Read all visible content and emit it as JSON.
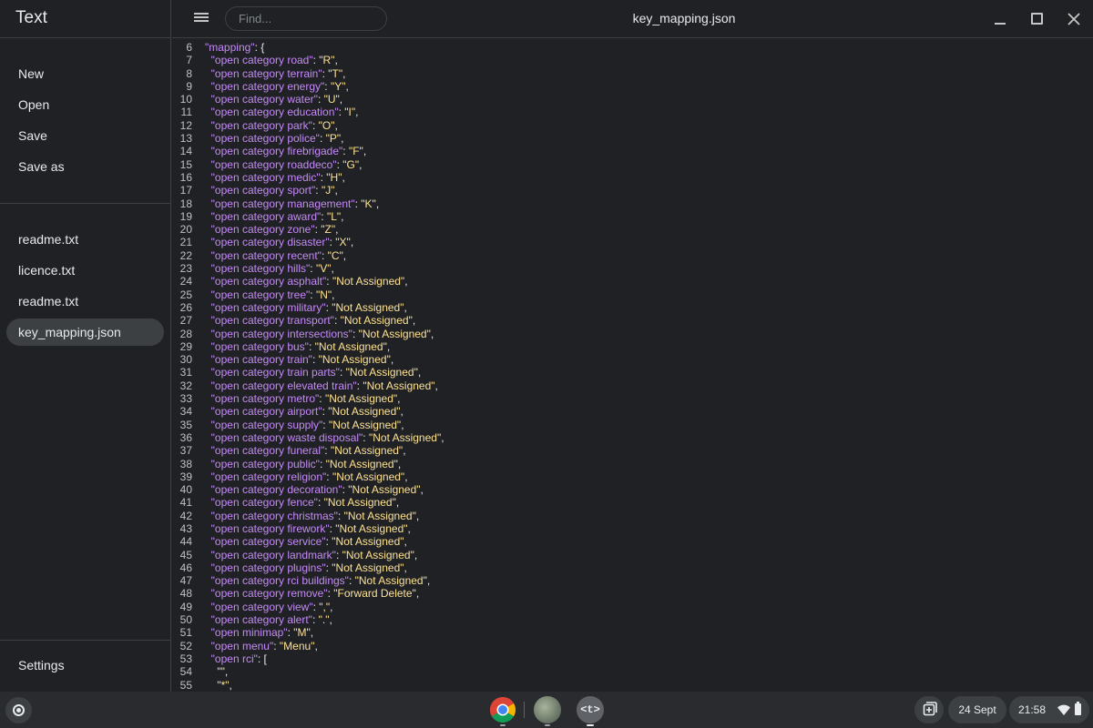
{
  "app": {
    "title": "Text"
  },
  "sidebar": {
    "actions": [
      {
        "label": "New"
      },
      {
        "label": "Open"
      },
      {
        "label": "Save"
      },
      {
        "label": "Save as"
      }
    ],
    "files": [
      {
        "label": "readme.txt",
        "active": false
      },
      {
        "label": "licence.txt",
        "active": false
      },
      {
        "label": "readme.txt",
        "active": false
      },
      {
        "label": "key_mapping.json",
        "active": true
      }
    ],
    "settings_label": "Settings"
  },
  "header": {
    "find_placeholder": "Find...",
    "file_title": "key_mapping.json"
  },
  "editor": {
    "lines": [
      {
        "n": "6",
        "key": "mapping",
        "val": "",
        "type": "open",
        "indent": ""
      },
      {
        "n": "7",
        "key": "open category road",
        "val": "R",
        "type": "kv",
        "indent": "  "
      },
      {
        "n": "8",
        "key": "open category terrain",
        "val": "T",
        "type": "kv",
        "indent": "  "
      },
      {
        "n": "9",
        "key": "open category energy",
        "val": "Y",
        "type": "kv",
        "indent": "  "
      },
      {
        "n": "10",
        "key": "open category water",
        "val": "U",
        "type": "kv",
        "indent": "  "
      },
      {
        "n": "11",
        "key": "open category education",
        "val": "I",
        "type": "kv",
        "indent": "  "
      },
      {
        "n": "12",
        "key": "open category park",
        "val": "O",
        "type": "kv",
        "indent": "  "
      },
      {
        "n": "13",
        "key": "open category police",
        "val": "P",
        "type": "kv",
        "indent": "  "
      },
      {
        "n": "14",
        "key": "open category firebrigade",
        "val": "F",
        "type": "kv",
        "indent": "  "
      },
      {
        "n": "15",
        "key": "open category roaddeco",
        "val": "G",
        "type": "kv",
        "indent": "  "
      },
      {
        "n": "16",
        "key": "open category medic",
        "val": "H",
        "type": "kv",
        "indent": "  "
      },
      {
        "n": "17",
        "key": "open category sport",
        "val": "J",
        "type": "kv",
        "indent": "  "
      },
      {
        "n": "18",
        "key": "open category management",
        "val": "K",
        "type": "kv",
        "indent": "  "
      },
      {
        "n": "19",
        "key": "open category award",
        "val": "L",
        "type": "kv",
        "indent": "  "
      },
      {
        "n": "20",
        "key": "open category zone",
        "val": "Z",
        "type": "kv",
        "indent": "  "
      },
      {
        "n": "21",
        "key": "open category disaster",
        "val": "X",
        "type": "kv",
        "indent": "  "
      },
      {
        "n": "22",
        "key": "open category recent",
        "val": "C",
        "type": "kv",
        "indent": "  "
      },
      {
        "n": "23",
        "key": "open category hills",
        "val": "V",
        "type": "kv",
        "indent": "  "
      },
      {
        "n": "24",
        "key": "open category asphalt",
        "val": "Not Assigned",
        "type": "kv",
        "indent": "  "
      },
      {
        "n": "25",
        "key": "open category tree",
        "val": "N",
        "type": "kv",
        "indent": "  "
      },
      {
        "n": "26",
        "key": "open category military",
        "val": "Not Assigned",
        "type": "kv",
        "indent": "  "
      },
      {
        "n": "27",
        "key": "open category transport",
        "val": "Not Assigned",
        "type": "kv",
        "indent": "  "
      },
      {
        "n": "28",
        "key": "open category intersections",
        "val": "Not Assigned",
        "type": "kv",
        "indent": "  "
      },
      {
        "n": "29",
        "key": "open category bus",
        "val": "Not Assigned",
        "type": "kv",
        "indent": "  "
      },
      {
        "n": "30",
        "key": "open category train",
        "val": "Not Assigned",
        "type": "kv",
        "indent": "  "
      },
      {
        "n": "31",
        "key": "open category train parts",
        "val": "Not Assigned",
        "type": "kv",
        "indent": "  "
      },
      {
        "n": "32",
        "key": "open category elevated train",
        "val": "Not Assigned",
        "type": "kv",
        "indent": "  "
      },
      {
        "n": "33",
        "key": "open category metro",
        "val": "Not Assigned",
        "type": "kv",
        "indent": "  "
      },
      {
        "n": "34",
        "key": "open category airport",
        "val": "Not Assigned",
        "type": "kv",
        "indent": "  "
      },
      {
        "n": "35",
        "key": "open category supply",
        "val": "Not Assigned",
        "type": "kv",
        "indent": "  "
      },
      {
        "n": "36",
        "key": "open category waste disposal",
        "val": "Not Assigned",
        "type": "kv",
        "indent": "  "
      },
      {
        "n": "37",
        "key": "open category funeral",
        "val": "Not Assigned",
        "type": "kv",
        "indent": "  "
      },
      {
        "n": "38",
        "key": "open category public",
        "val": "Not Assigned",
        "type": "kv",
        "indent": "  "
      },
      {
        "n": "39",
        "key": "open category religion",
        "val": "Not Assigned",
        "type": "kv",
        "indent": "  "
      },
      {
        "n": "40",
        "key": "open category decoration",
        "val": "Not Assigned",
        "type": "kv",
        "indent": "  "
      },
      {
        "n": "41",
        "key": "open category fence",
        "val": "Not Assigned",
        "type": "kv",
        "indent": "  "
      },
      {
        "n": "42",
        "key": "open category christmas",
        "val": "Not Assigned",
        "type": "kv",
        "indent": "  "
      },
      {
        "n": "43",
        "key": "open category firework",
        "val": "Not Assigned",
        "type": "kv",
        "indent": "  "
      },
      {
        "n": "44",
        "key": "open category service",
        "val": "Not Assigned",
        "type": "kv",
        "indent": "  "
      },
      {
        "n": "45",
        "key": "open category landmark",
        "val": "Not Assigned",
        "type": "kv",
        "indent": "  "
      },
      {
        "n": "46",
        "key": "open category plugins",
        "val": "Not Assigned",
        "type": "kv",
        "indent": "  "
      },
      {
        "n": "47",
        "key": "open category rci buildings",
        "val": "Not Assigned",
        "type": "kv",
        "indent": "  "
      },
      {
        "n": "48",
        "key": "open category remove",
        "val": "Forward Delete",
        "type": "kv",
        "indent": "  "
      },
      {
        "n": "49",
        "key": "open category view",
        "val": ",",
        "type": "kv",
        "indent": "  "
      },
      {
        "n": "50",
        "key": "open category alert",
        "val": ".",
        "type": "kv",
        "indent": "  "
      },
      {
        "n": "51",
        "key": "open minimap",
        "val": "M",
        "type": "kv",
        "indent": "  "
      },
      {
        "n": "52",
        "key": "open menu",
        "val": "Menu",
        "type": "kv",
        "indent": "  "
      },
      {
        "n": "53",
        "key": "open rci",
        "val": "",
        "type": "arr",
        "indent": "  "
      },
      {
        "n": "54",
        "key": "",
        "val": "",
        "type": "item",
        "indent": "    "
      },
      {
        "n": "55",
        "key": "",
        "val": "*",
        "type": "item",
        "indent": "    "
      }
    ]
  },
  "shelf": {
    "date": "24 Sept",
    "time": "21:58",
    "text_app_glyph": "<t>",
    "icons": [
      "launcher-icon",
      "chrome-icon",
      "photos-icon",
      "text-app-icon",
      "holding-space-icon",
      "wifi-icon",
      "battery-icon"
    ]
  },
  "colors": {
    "background": "#202124",
    "key": "#c58af9",
    "string": "#fde293",
    "active_item": "#3c4043"
  }
}
